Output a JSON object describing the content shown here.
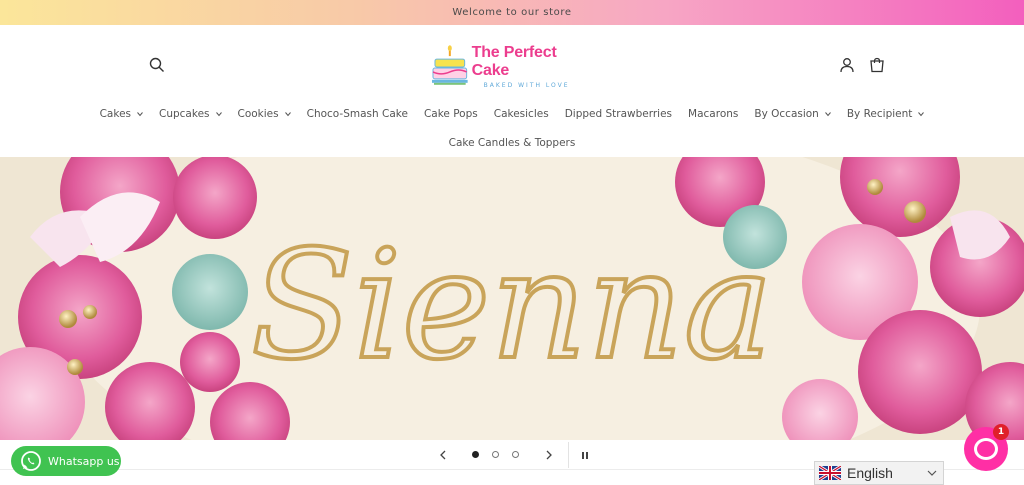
{
  "announcement": {
    "text": "Welcome to our store"
  },
  "header": {
    "logo": {
      "name": "The Perfect Cake",
      "tagline": "BAKED WITH LOVE"
    }
  },
  "nav": {
    "row1": [
      {
        "label": "Cakes",
        "dropdown": true
      },
      {
        "label": "Cupcakes",
        "dropdown": true
      },
      {
        "label": "Cookies",
        "dropdown": true
      },
      {
        "label": "Choco-Smash Cake",
        "dropdown": false
      },
      {
        "label": "Cake Pops",
        "dropdown": false
      },
      {
        "label": "Cakesicles",
        "dropdown": false
      },
      {
        "label": "Dipped Strawberries",
        "dropdown": false
      },
      {
        "label": "Macarons",
        "dropdown": false
      },
      {
        "label": "By Occasion",
        "dropdown": true
      },
      {
        "label": "By Recipient",
        "dropdown": true
      }
    ],
    "row2": [
      {
        "label": "Cake Candles & Toppers",
        "dropdown": false
      }
    ]
  },
  "hero": {
    "topper_text": "Sienna",
    "slides_total": 3,
    "active_slide": 1
  },
  "whatsapp": {
    "label": "Whatsapp us"
  },
  "language": {
    "label": "English"
  },
  "chat": {
    "badge": "1"
  },
  "colors": {
    "brand_pink": "#ec3d8e",
    "whatsapp_green": "#40c351",
    "chat_pink": "#ff2fa5"
  },
  "icons": [
    "search-icon",
    "account-icon",
    "cart-icon",
    "chevron-left-icon",
    "chevron-right-icon",
    "pause-icon",
    "whatsapp-icon",
    "uk-flag-icon",
    "chat-icon"
  ]
}
